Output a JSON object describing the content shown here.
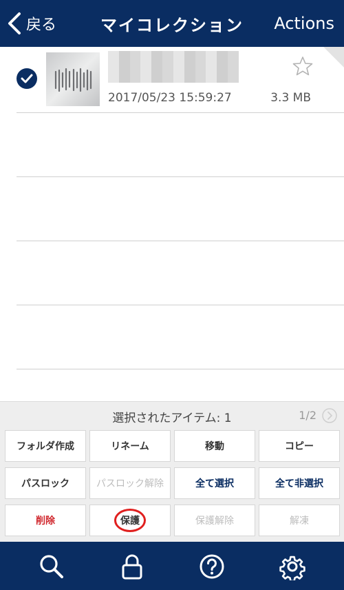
{
  "navbar": {
    "back_label": "戻る",
    "title": "マイコレクション",
    "actions_label": "Actions"
  },
  "file": {
    "date": "2017/05/23 15:59:27",
    "size": "3.3 MB"
  },
  "panel": {
    "selected_text": "選択されたアイテム: 1",
    "page_indicator": "1/2",
    "buttons": [
      {
        "label": "フォルダ作成"
      },
      {
        "label": "リネーム"
      },
      {
        "label": "移動"
      },
      {
        "label": "コピー"
      },
      {
        "label": "パスロック"
      },
      {
        "label": "パスロック解除"
      },
      {
        "label": "全て選択"
      },
      {
        "label": "全て非選択"
      },
      {
        "label": "削除"
      },
      {
        "label": "保護"
      },
      {
        "label": "保護解除"
      },
      {
        "label": "解凍"
      }
    ]
  },
  "tabbar": {
    "icons": [
      "search-icon",
      "lock-icon",
      "help-icon",
      "settings-icon"
    ]
  },
  "colors": {
    "brand": "#0a2d62",
    "delete": "#d0282e",
    "highlight_circle": "#e0201f"
  }
}
